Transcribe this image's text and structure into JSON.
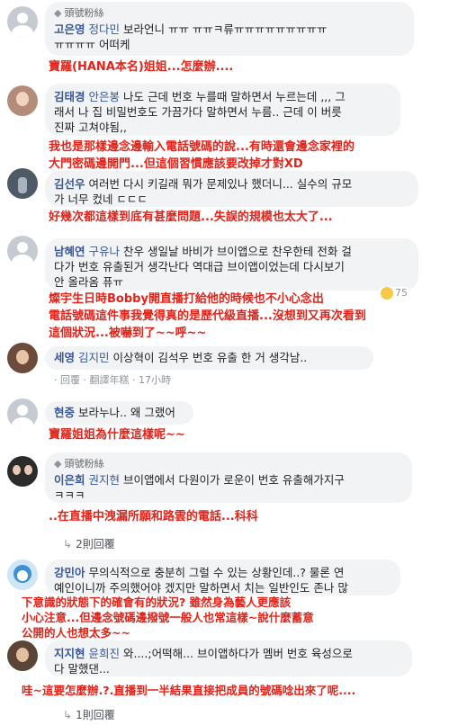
{
  "comments": [
    {
      "badge": "頭號粉絲",
      "author": "고은영",
      "tag": "정다민",
      "text_line1": " 보라언니 ㅠㅠ ㅠㅠㅋ류ㅠㅠㅠㅠㅠㅠㅠㅠㅠ",
      "text_line2": "ㅠㅠㅠㅠ 어떠케",
      "translation": "寶羅(HANA本名)姐姐...怎麼辦...."
    },
    {
      "author": "김태경",
      "tag": "안은봉",
      "text_line1": " 나도 근데 번호 누를때 말하면서 누르는데 ,,, 그",
      "text_line2": "래서 나 집 비밀번호도 가끔가다 말하면서 누름.. 근데 이 버릇",
      "text_line3": "진짜 고쳐야됨,,",
      "translation_line1": "我也是那樣邊念邊輸入電話號碼的說...有時還會邊念家裡的",
      "translation_line2": "大門密碼邊開門...但這個習慣應該要改掉才對XD"
    },
    {
      "author": "김선우",
      "text_line1": " 여러번 다시 키길래 뭐가 문제있나 했더니... 실수의 규모",
      "text_line2": "가 너무 컸네 ㄷㄷㄷ",
      "translation": "好幾次都這樣到底有甚麼問題...失誤的規模也太大了..."
    },
    {
      "author": "남혜연",
      "tag": "구유나",
      "text_line1": " 찬우 생일날 바비가 브이앱으로 찬우한테 전화 걸",
      "text_line2": "다가 번호 유출된거 생각난다 역대급 브이앱이었는데 다시보기",
      "text_line3": "안 올라옴 퓨ㅠ",
      "reaction_count": "75",
      "translation_line1": "燦宇生日時Bobby開直播打給他的時候也不小心念出",
      "translation_line2": "電話號碼這件事我覺得真的是歷代級直播...沒想到又再次看到",
      "translation_line3": "這個狀況...被嚇到了~~呼~~"
    },
    {
      "author": "세영",
      "tag": "김지민",
      "text_line1": " 이상혁이 김석우 번호 유출 한 거 생각남..",
      "actions": "· 回覆 · 翻譯年糕 · 17小時"
    },
    {
      "author": "현중",
      "text_line1": " 보라누나.. 왜 그랬어",
      "translation": "寶羅姐姐為什麼這樣呢~~"
    },
    {
      "badge": "頭號粉絲",
      "author": "이은희",
      "tag": "권지현",
      "text_line1": " 브이앱에서 다원이가 로운이 번호 유출해가지구",
      "text_line2": "ㅋㅋㅋ",
      "translation": "..在直播中洩漏所願和路雲的電話...科科",
      "replies": "2則回覆"
    },
    {
      "author": "강민아",
      "text_line1": " 무의식적으로 충분히 그럴 수 있는 상황인데..? 물론 연",
      "text_line2": "예인이니까 주의했어야 겠지만 말하면서 치는 일반인도 존나 많",
      "translation_line1": "下意識的狀態下的確會有的狀況? 雖然身為藝人更應該",
      "translation_line2": "小心注意...但邊念號碼邊撥號一般人也常這樣~說什麼蓄意",
      "translation_line3": "公開的人也想太多~~"
    },
    {
      "author": "지지현",
      "tag": "윤희진",
      "text_line1": " 와....;어떡해... 브이앱하다가 멤버 번호 육성으로",
      "text_line2": "다 말했댄...",
      "translation": "哇~這要怎麼辦.?.直播到一半結果直接把成員的號碼唸出來了呢....",
      "replies": "1則回覆"
    }
  ],
  "colors": {
    "name_blue": "#385898",
    "translation_red": "#e2231a",
    "bubble_bg": "#f2f3f5"
  }
}
